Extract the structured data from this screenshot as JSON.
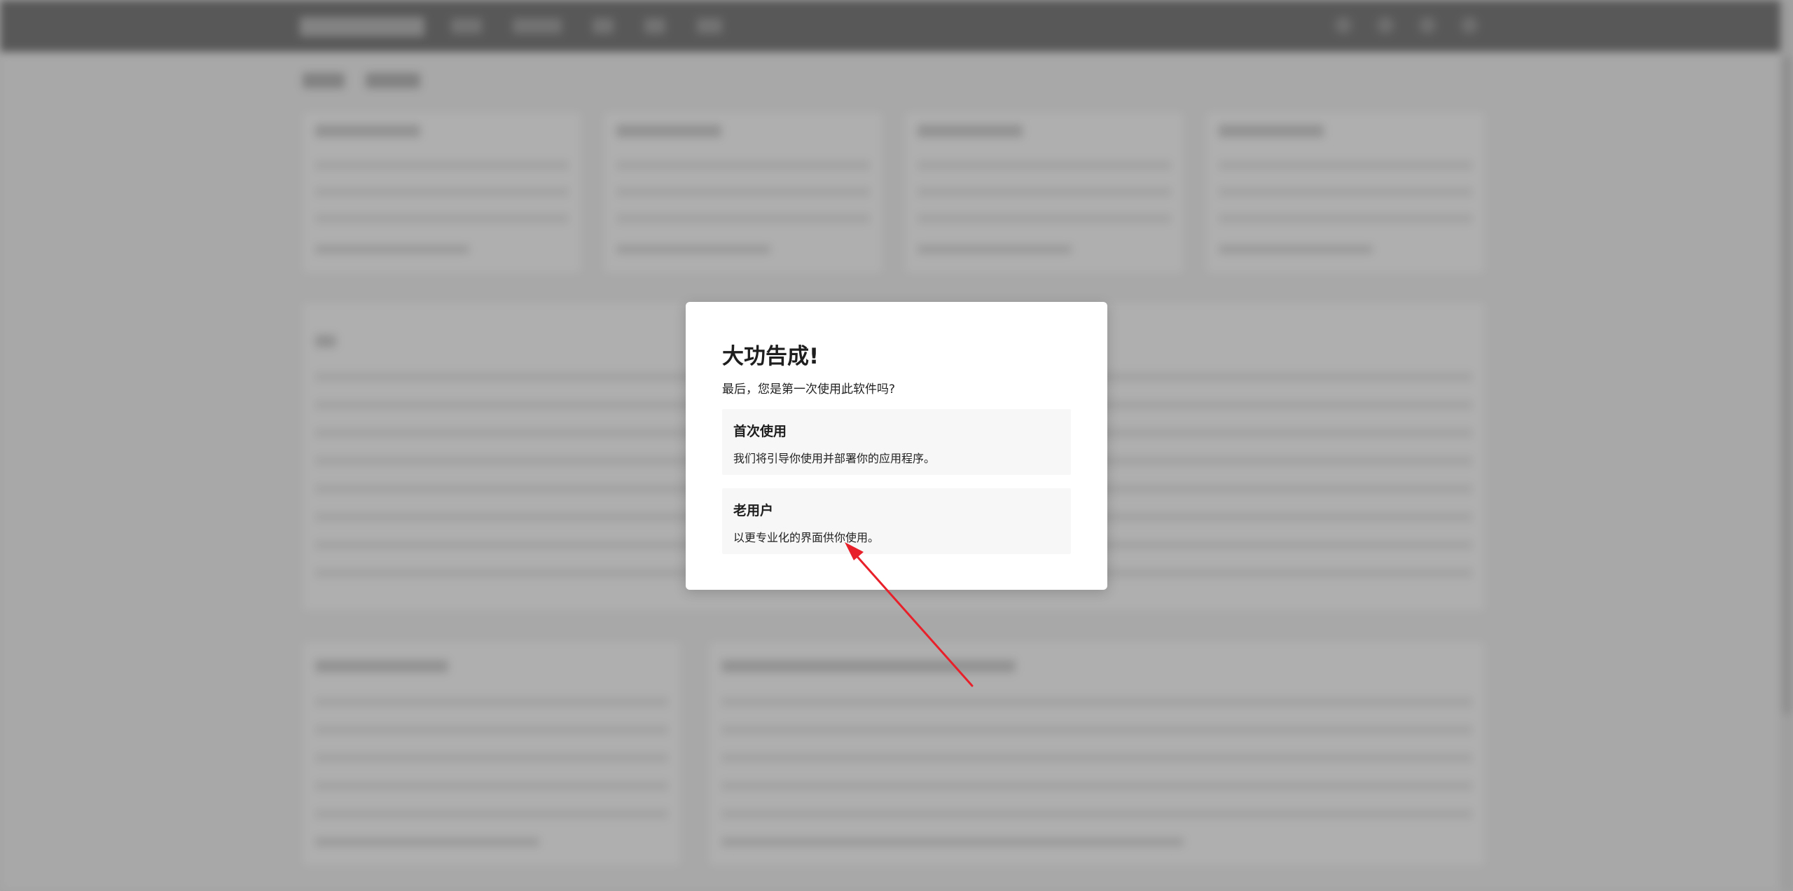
{
  "modal": {
    "title": "大功告成!",
    "question": "最后，您是第一次使用此软件吗?",
    "options": [
      {
        "title": "首次使用",
        "description": "我们将引导你使用并部署你的应用程序。"
      },
      {
        "title": "老用户",
        "description": "以更专业化的界面供你使用。"
      }
    ]
  },
  "colors": {
    "overlay": "#bdbdbd",
    "topbar": "#3f3f3f",
    "option_background": "#f7f7f7",
    "arrow": "#e8202a"
  },
  "annotation": {
    "type": "arrow",
    "target": "opt-old"
  }
}
